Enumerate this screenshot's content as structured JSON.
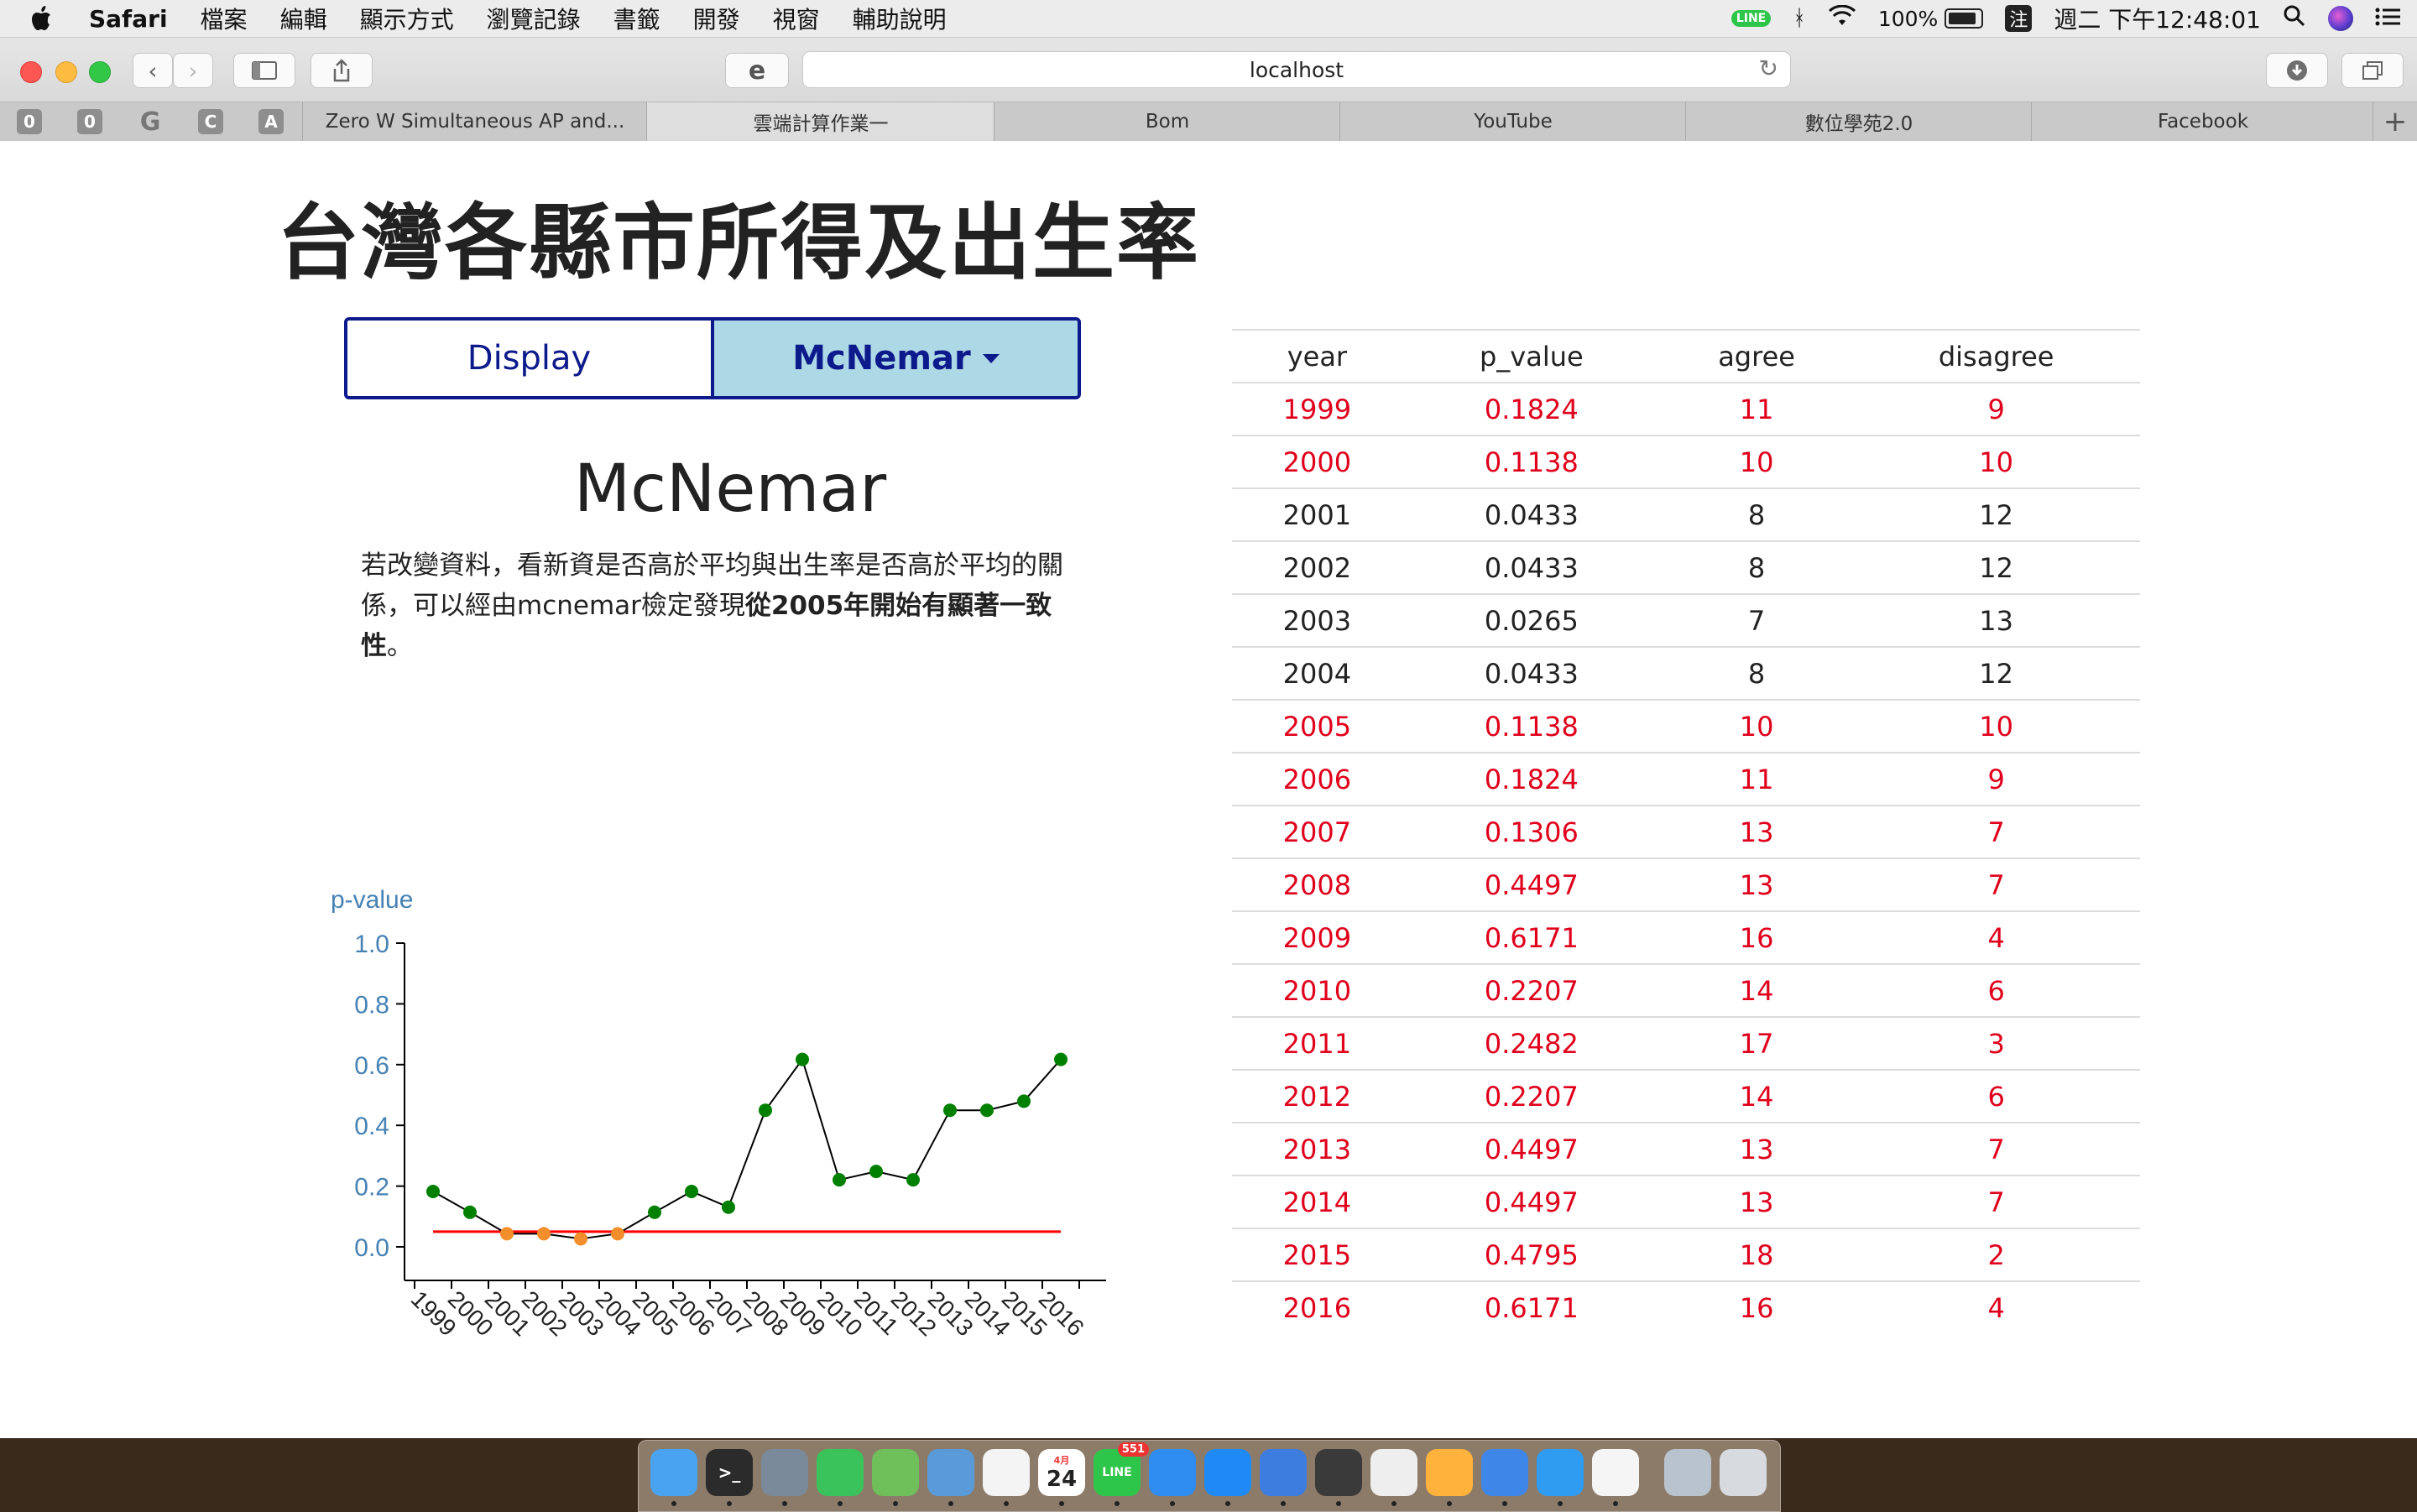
{
  "menubar": {
    "app": "Safari",
    "menus": [
      "檔案",
      "編輯",
      "顯示方式",
      "瀏覽記錄",
      "書籤",
      "開發",
      "視窗",
      "輔助說明"
    ],
    "line_badge": "LINE",
    "battery": "100%",
    "ime": "注",
    "clock": "週二 下午12:48:01",
    "icons": [
      "apple-icon",
      "line-icon",
      "bluetooth-icon",
      "wifi-icon",
      "battery-icon",
      "search-icon",
      "siri-icon",
      "notification-list-icon"
    ]
  },
  "toolbar": {
    "url": "localhost"
  },
  "tabs": {
    "pinned": [
      "0",
      "0",
      "G",
      "C",
      "A"
    ],
    "items": [
      {
        "label": "Zero W Simultaneous AP and...",
        "active": false
      },
      {
        "label": "雲端計算作業一",
        "active": true
      },
      {
        "label": "Bom",
        "active": false
      },
      {
        "label": "YouTube",
        "active": false
      },
      {
        "label": "數位學苑2.0",
        "active": false
      },
      {
        "label": "Facebook",
        "active": false
      }
    ],
    "add": "+"
  },
  "page": {
    "title": "台灣各縣市所得及出生率",
    "buttons": {
      "display": "Display",
      "mcnemar": "McNemar"
    },
    "section_title": "McNemar",
    "desc_plain": "若改變資料，看新資是否高於平均與出生率是否高於平均的關係，可以經由mcnemar檢定發現",
    "desc_bold": "從2005年開始有顯著一致性",
    "desc_end": "。"
  },
  "chart_data": {
    "type": "line",
    "ylabel": "p-value",
    "categories": [
      "1999",
      "2000",
      "2001",
      "2002",
      "2003",
      "2004",
      "2005",
      "2006",
      "2007",
      "2008",
      "2009",
      "2010",
      "2011",
      "2012",
      "2013",
      "2014",
      "2015",
      "2016"
    ],
    "series": [
      {
        "values": [
          0.1824,
          0.1138,
          0.0433,
          0.0433,
          0.0265,
          0.0433,
          0.1138,
          0.1824,
          0.1306,
          0.4497,
          0.6171,
          0.2207,
          0.2482,
          0.2207,
          0.4497,
          0.4497,
          0.4795,
          0.6171
        ]
      }
    ],
    "threshold": 0.05,
    "ylim": [
      0,
      1.0
    ],
    "yticks": [
      "0.0",
      "0.2",
      "0.4",
      "0.6",
      "0.8",
      "1.0"
    ],
    "colors": {
      "line": "#000000",
      "significant": "#f28e2b",
      "nonsignificant": "#008000",
      "threshold": "#ff0000",
      "axis_label": "#4682b4"
    }
  },
  "table": {
    "headers": [
      "year",
      "p_value",
      "agree",
      "disagree"
    ],
    "rows": [
      [
        "1999",
        "0.1824",
        "11",
        "9"
      ],
      [
        "2000",
        "0.1138",
        "10",
        "10"
      ],
      [
        "2001",
        "0.0433",
        "8",
        "12"
      ],
      [
        "2002",
        "0.0433",
        "8",
        "12"
      ],
      [
        "2003",
        "0.0265",
        "7",
        "13"
      ],
      [
        "2004",
        "0.0433",
        "8",
        "12"
      ],
      [
        "2005",
        "0.1138",
        "10",
        "10"
      ],
      [
        "2006",
        "0.1824",
        "11",
        "9"
      ],
      [
        "2007",
        "0.1306",
        "13",
        "7"
      ],
      [
        "2008",
        "0.4497",
        "13",
        "7"
      ],
      [
        "2009",
        "0.6171",
        "16",
        "4"
      ],
      [
        "2010",
        "0.2207",
        "14",
        "6"
      ],
      [
        "2011",
        "0.2482",
        "17",
        "3"
      ],
      [
        "2012",
        "0.2207",
        "14",
        "6"
      ],
      [
        "2013",
        "0.4497",
        "13",
        "7"
      ],
      [
        "2014",
        "0.4497",
        "13",
        "7"
      ],
      [
        "2015",
        "0.4795",
        "18",
        "2"
      ],
      [
        "2016",
        "0.6171",
        "16",
        "4"
      ]
    ]
  },
  "dock": {
    "calendar_day": "24",
    "calendar_month": "4月",
    "line_badge": "551",
    "icons": [
      "finder-icon",
      "terminal-icon",
      "launchpad-icon",
      "facetime-icon",
      "maps-icon",
      "preview-icon",
      "photos-icon",
      "calendar-icon",
      "line-icon",
      "safari-icon",
      "app-store-icon",
      "xcode-icon",
      "vmware-icon",
      "numbers-icon",
      "pages-icon",
      "keynote-icon",
      "messages-icon",
      "textedit-icon",
      "downloads-folder-icon",
      "trash-icon"
    ]
  }
}
